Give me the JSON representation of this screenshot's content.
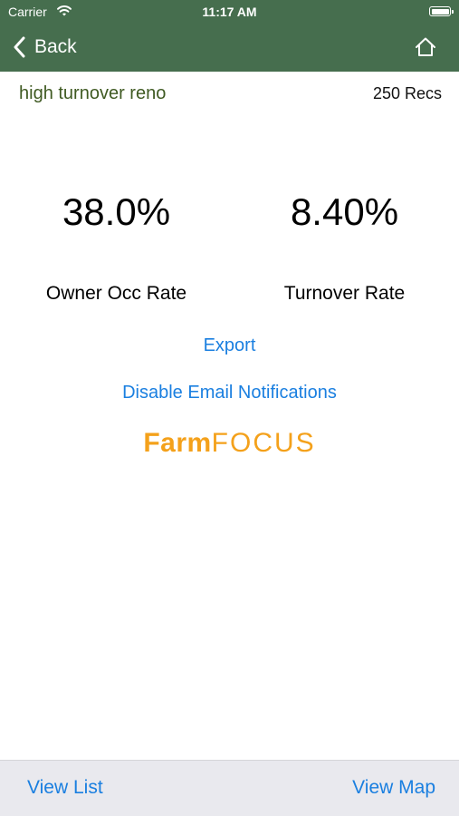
{
  "status_bar": {
    "carrier": "Carrier",
    "time": "11:17 AM"
  },
  "nav": {
    "back_label": "Back",
    "home_icon": "home-icon"
  },
  "search": {
    "name": "high turnover reno",
    "record_count": "250 Recs"
  },
  "stats": {
    "owner_occ": {
      "value": "38.0%",
      "label": "Owner Occ Rate"
    },
    "turnover": {
      "value": "8.40%",
      "label": "Turnover Rate"
    }
  },
  "actions": {
    "export_label": "Export",
    "disable_email_label": "Disable Email Notifications"
  },
  "logo": {
    "part1": "Farm",
    "part2": "FOCUS",
    "color": "#f4a11b"
  },
  "bottom": {
    "view_list_label": "View List",
    "view_map_label": "View Map"
  },
  "colors": {
    "header": "#466e4e",
    "link": "#1a7fe0",
    "bottom_bar": "#e9e9ee"
  }
}
